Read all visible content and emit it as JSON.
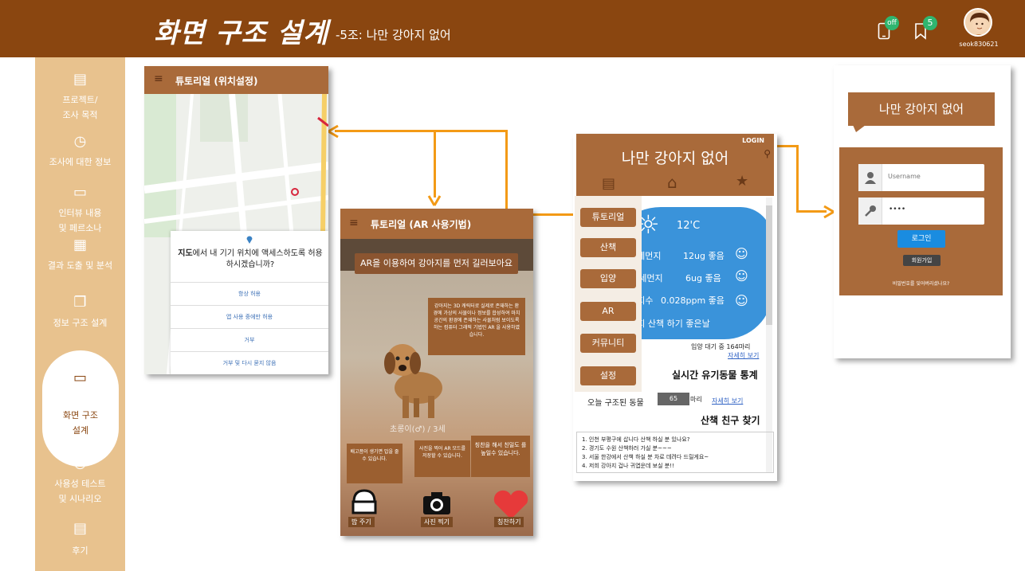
{
  "header": {
    "title": "화면 구조 설계",
    "subtitle": "-5조: 나만 강아지 없어",
    "phone_badge": "off",
    "bookmark_badge": "5",
    "username": "seok830621"
  },
  "sidebar": {
    "items": [
      {
        "label1": "프로젝트/",
        "label2": "조사 목적"
      },
      {
        "label1": "조사에 대한 정보",
        "label2": ""
      },
      {
        "label1": "인터뷰 내용",
        "label2": "및 페르소나"
      },
      {
        "label1": "결과 도출 및 분석",
        "label2": ""
      },
      {
        "label1": "정보 구조 설계",
        "label2": ""
      },
      {
        "label1": "화면 구조",
        "label2": "설계"
      },
      {
        "label1": "사용성 테스트",
        "label2": "및 시나리오"
      },
      {
        "label1": "후기",
        "label2": ""
      }
    ]
  },
  "screen1": {
    "title": "튜토리얼 (위치설정)",
    "prompt": "지도에서 내 기기 위치에 액세스하도록 허용하시겠습니까?",
    "prompt_bold": "지도",
    "prompt_rest": "에서 내 기기 위치에 액세스하도록 허용하시겠습니까?",
    "options": [
      "항상 허용",
      "앱 사용 중에만 허용",
      "거부",
      "거부 및 다시 묻지 않음"
    ]
  },
  "screen2": {
    "title": "튜토리얼 (AR 사용기법)",
    "banner": "AR을 이용하여 강아지를 먼저 길러보아요",
    "info": "강아지는 3D 캐릭터로 실제로 존재하는 환경에 가상의 사물이나 정보를 합성하여 마치 공간의 환경에 존재하는 사물처럼 보이도록 하는 컴퓨터 그래픽 기법인 AR 을 사용하였습니다.",
    "dog_info": "초롱이(♂) / 3세",
    "tip1": "배고픔이 생기면 밥을 줄 수 있습니다.",
    "tip2": "사진을 찍어 AR 모드를 저장할 수 있습니다.",
    "tip3": "칭찬을 해서 친밀도 를 높일수 있습니다.",
    "btn_feed": "밥 주기",
    "btn_photo": "사진 찍기",
    "btn_praise": "칭찬하기"
  },
  "screen3": {
    "login": "LOGIN",
    "title": "나만 강아지 없어",
    "menu": [
      "튜토리얼",
      "산책",
      "입양",
      "AR",
      "커뮤니티",
      "설정"
    ],
    "temp": "12'C",
    "dust_label": "미세먼지",
    "dust_value": "12ug 좋음",
    "fine_label": "초미세먼지",
    "fine_value": "6ug 좋음",
    "ozone_label": "오존지수",
    "ozone_value": "0.028ppm 좋음",
    "walk_msg": "강아지 산책 하기 좋은날",
    "waiting": "입양 대기 중 164마리",
    "more1": "자세히 보기",
    "section1": "실시간 유기동물 통계",
    "rescued_label": "오늘 구조된 동물",
    "rescued_value": "65",
    "rescued_unit": "마리",
    "more2": "자세히 보기",
    "section2": "산책 친구 찾기",
    "posts": [
      "1. 인천 부평구에 삽니다 산책 하실 분 있나요?",
      "2. 경기도 수원 산책하러 가실 분~~~",
      "3. 서울 한강에서 산책 하실 분 차로 데려다 드릴게요~",
      "4. 저희 강아지 겁나 귀엽운데 보실 분!!"
    ]
  },
  "screen4": {
    "title": "나만 강아지 없어",
    "username_placeholder": "Username",
    "password_value": "••••",
    "login_btn": "로그인",
    "signup_btn": "회원가입",
    "forgot": "비밀번호를 잊어버리셨나요?"
  }
}
